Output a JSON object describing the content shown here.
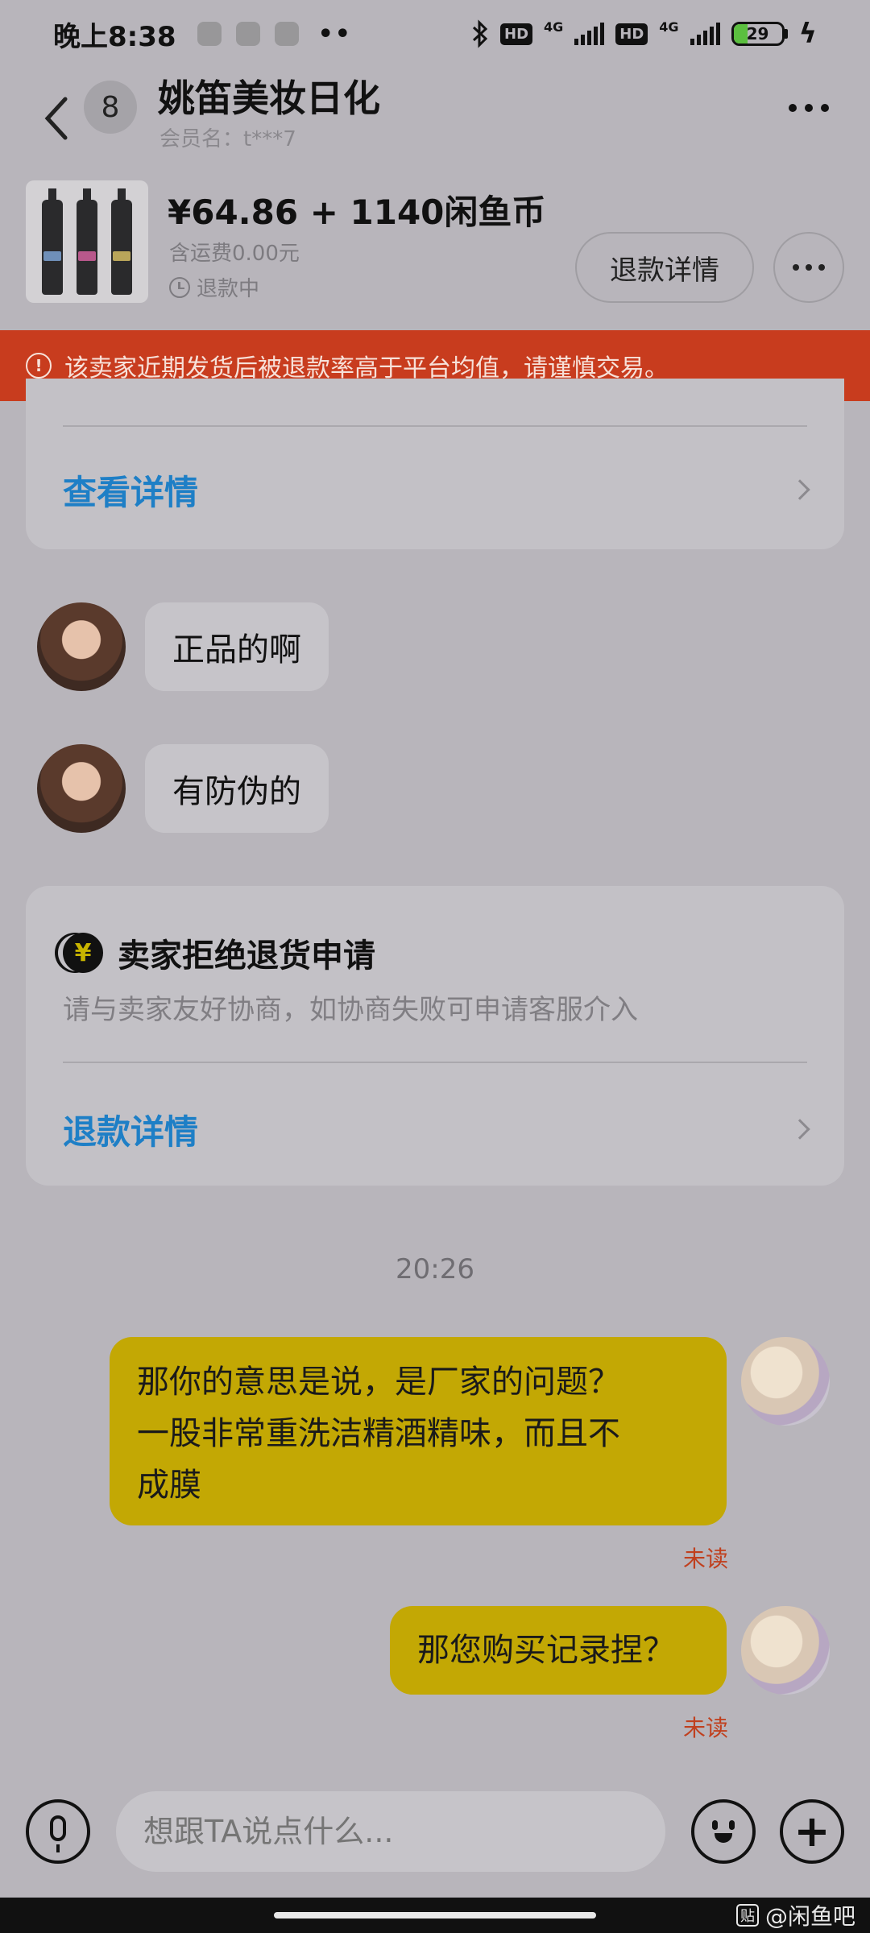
{
  "status_bar": {
    "time": "晚上8:38",
    "more": "••",
    "hd1": "HD",
    "net1": "4G",
    "hd2": "HD",
    "net2": "4G",
    "battery": "29",
    "battery_level": 0.29,
    "battery_color": "#5bbf3f"
  },
  "header": {
    "unread_count": "8",
    "title": "姚笛美妆日化",
    "member": "会员名：t***7"
  },
  "product": {
    "price": "¥64.86 + 1140闲鱼币",
    "shipping": "含运费0.00元",
    "status": "退款中",
    "refund_button": "退款详情",
    "label_colors": [
      "#6f8fb8",
      "#b8588b",
      "#b9a55a"
    ]
  },
  "warning": {
    "text": "该卖家近期发货后被退款率高于平台均值，请谨慎交易。",
    "icon": "!",
    "color": "#c83c1e"
  },
  "top_card": {
    "link": "查看详情"
  },
  "messages_in": [
    {
      "text": "正品的啊"
    },
    {
      "text": "有防伪的"
    }
  ],
  "system_card": {
    "icon": "¥",
    "title": "卖家拒绝退货申请",
    "subtitle": "请与卖家友好协商，如协商失败可申请客服介入",
    "link": "退款详情"
  },
  "timestamp": "20:26",
  "messages_out": [
    {
      "lines": [
        "那你的意思是说，是厂家的问题？",
        "一股非常重洗洁精酒精味，而且不",
        "成膜"
      ],
      "status": "未读"
    },
    {
      "lines": [
        "那您购买记录捏？"
      ],
      "status": "未读"
    }
  ],
  "input": {
    "placeholder": "想跟TA说点什么..."
  },
  "watermark": {
    "badge": "贴",
    "text": "@闲鱼吧"
  }
}
